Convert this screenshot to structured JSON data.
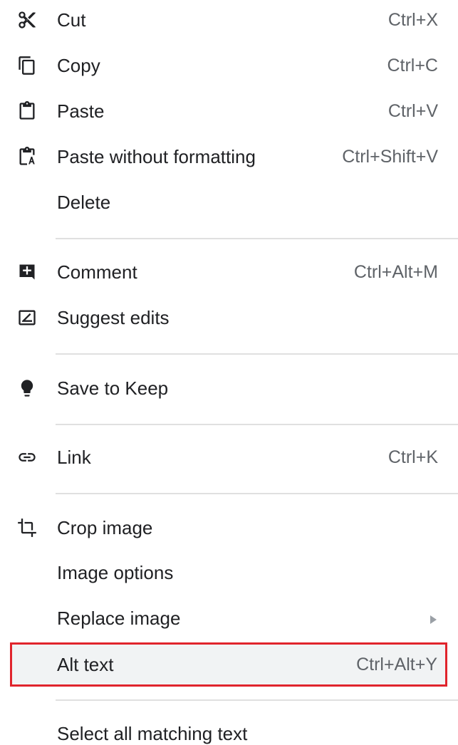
{
  "menu": {
    "cut": {
      "label": "Cut",
      "shortcut": "Ctrl+X",
      "icon": "scissors-icon"
    },
    "copy": {
      "label": "Copy",
      "shortcut": "Ctrl+C",
      "icon": "copy-icon"
    },
    "paste": {
      "label": "Paste",
      "shortcut": "Ctrl+V",
      "icon": "clipboard-icon"
    },
    "paste_plain": {
      "label": "Paste without formatting",
      "shortcut": "Ctrl+Shift+V",
      "icon": "paste-plain-icon"
    },
    "delete": {
      "label": "Delete"
    },
    "comment": {
      "label": "Comment",
      "shortcut": "Ctrl+Alt+M",
      "icon": "add-comment-icon"
    },
    "suggest": {
      "label": "Suggest edits",
      "icon": "suggest-edits-icon"
    },
    "keep": {
      "label": "Save to Keep",
      "icon": "lightbulb-icon"
    },
    "link": {
      "label": "Link",
      "shortcut": "Ctrl+K",
      "icon": "link-icon"
    },
    "crop": {
      "label": "Crop image",
      "icon": "crop-icon"
    },
    "image_options": {
      "label": "Image options"
    },
    "replace_image": {
      "label": "Replace image",
      "icon": "submenu-arrow-icon"
    },
    "alt_text": {
      "label": "Alt text",
      "shortcut": "Ctrl+Alt+Y"
    },
    "select_matching": {
      "label": "Select all matching text"
    }
  },
  "colors": {
    "text": "#202124",
    "shortcut": "#5f6368",
    "icon": "#202124",
    "divider": "#e0e0e0",
    "highlight_bg": "#f1f3f4",
    "highlight_border": "#e0242c"
  }
}
